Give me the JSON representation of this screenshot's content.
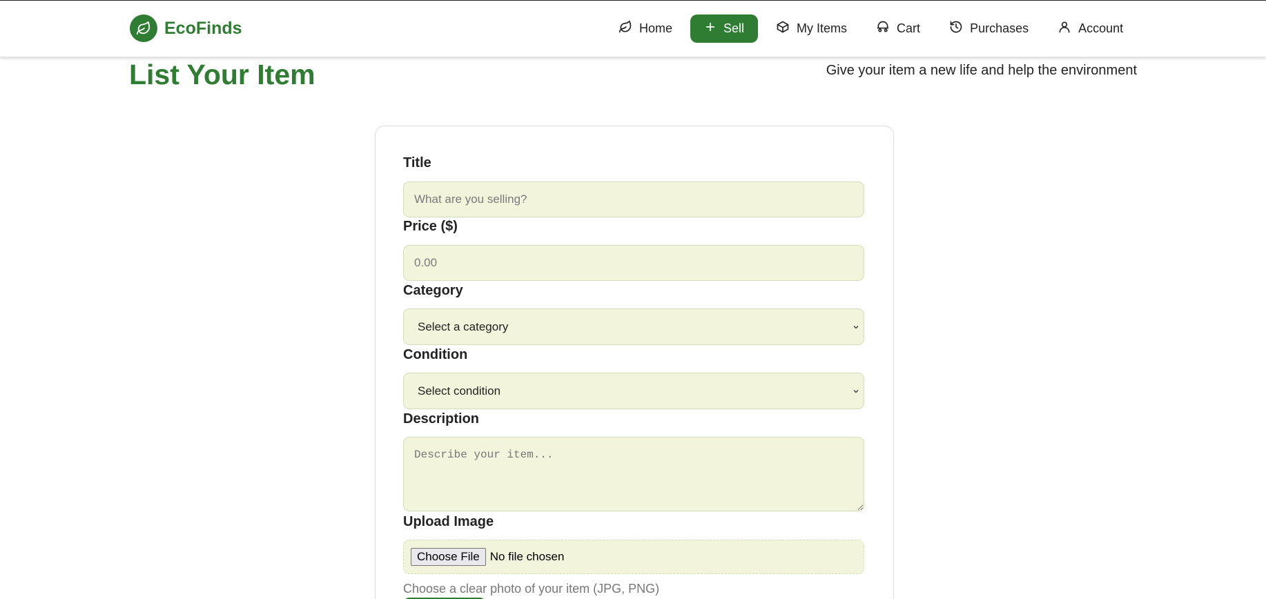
{
  "brand": {
    "name": "EcoFinds",
    "icon": "leaf-icon",
    "color": "#2e7d32"
  },
  "nav": {
    "items": [
      {
        "label": "Home",
        "icon": "leaf-icon",
        "active": false
      },
      {
        "label": "Sell",
        "icon": "plus-icon",
        "active": true
      },
      {
        "label": "My Items",
        "icon": "box-icon",
        "active": false
      },
      {
        "label": "Cart",
        "icon": "cart-icon",
        "active": false
      },
      {
        "label": "Purchases",
        "icon": "history-icon",
        "active": false
      },
      {
        "label": "Account",
        "icon": "user-icon",
        "active": false
      }
    ]
  },
  "page": {
    "title": "List Your Item",
    "subtitle": "Give your item a new life and help the environment"
  },
  "form": {
    "title": {
      "label": "Title",
      "value": "",
      "placeholder": "What are you selling?"
    },
    "price": {
      "label": "Price ($)",
      "value": "",
      "placeholder": "0.00"
    },
    "category": {
      "label": "Category",
      "selected": "Select a category"
    },
    "condition": {
      "label": "Condition",
      "selected": "Select condition"
    },
    "description": {
      "label": "Description",
      "value": "",
      "placeholder": "Describe your item..."
    },
    "image": {
      "label": "Upload Image",
      "button_label": "Choose File",
      "status": "No file chosen",
      "hint": "Choose a clear photo of your item (JPG, PNG)"
    }
  },
  "colors": {
    "accent": "#2e7d32",
    "input_bg": "#f3f4dc",
    "input_border": "#cfe0b8"
  }
}
